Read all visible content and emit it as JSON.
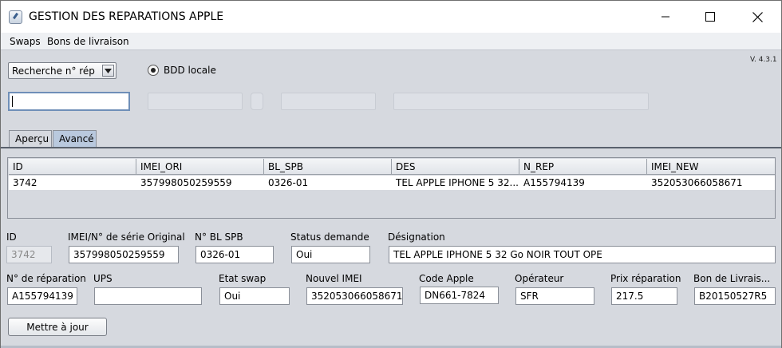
{
  "window": {
    "title": "GESTION DES REPARATIONS APPLE"
  },
  "menu": {
    "items": [
      "Swaps",
      "Bons de livraison"
    ]
  },
  "version": "V. 4.3.1",
  "search": {
    "mode_selected": "Recherche n° rép",
    "radio_label": "BDD locale",
    "input_value": ""
  },
  "tabs": [
    "Aperçu",
    "Avancé"
  ],
  "table": {
    "columns": [
      "ID",
      "IMEI_ORI",
      "BL_SPB",
      "DES",
      "N_REP",
      "IMEI_NEW"
    ],
    "rows": [
      [
        "3742",
        "357998050259559",
        "0326-01",
        "TEL APPLE IPHONE 5 32...",
        "A155794139",
        "352053066058671"
      ]
    ]
  },
  "details": {
    "id_label": "ID",
    "id_value": "3742",
    "imei_ori_label": "IMEI/N° de série Original",
    "imei_ori_value": "357998050259559",
    "bl_spb_label": "N° BL SPB",
    "bl_spb_value": "0326-01",
    "status_label": "Status demande",
    "status_value": "Oui",
    "designation_label": "Désignation",
    "designation_value": "TEL APPLE IPHONE 5 32 Go NOIR TOUT OPE",
    "n_rep_label": "N° de réparation",
    "n_rep_value": "A155794139",
    "ups_label": "UPS",
    "ups_value": "",
    "etat_swap_label": "Etat swap",
    "etat_swap_value": "Oui",
    "imei_new_label": "Nouvel IMEI",
    "imei_new_value": "352053066058671",
    "code_apple_label": "Code Apple",
    "code_apple_value": "DN661-7824",
    "operateur_label": "Opérateur",
    "operateur_value": "SFR",
    "prix_label": "Prix réparation",
    "prix_value": "217.5",
    "bon_livraison_label": "Bon de Livrais...",
    "bon_livraison_value": "B20150527R5"
  },
  "buttons": {
    "update": "Mettre à jour"
  }
}
